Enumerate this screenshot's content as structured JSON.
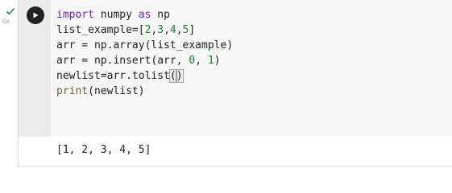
{
  "cell_status": {
    "executed_icon": "check-icon",
    "duration": "0s",
    "success_color": "#1e8e3e"
  },
  "run_button": {
    "icon": "play-icon"
  },
  "code": {
    "lines": [
      [
        {
          "t": "import",
          "c": "kw"
        },
        {
          "t": " numpy "
        },
        {
          "t": "as",
          "c": "kw"
        },
        {
          "t": " np"
        }
      ],
      [
        {
          "t": "list_example=["
        },
        {
          "t": "2",
          "c": "num"
        },
        {
          "t": ","
        },
        {
          "t": "3",
          "c": "num"
        },
        {
          "t": ","
        },
        {
          "t": "4",
          "c": "num"
        },
        {
          "t": ","
        },
        {
          "t": "5",
          "c": "num"
        },
        {
          "t": "]"
        }
      ],
      [
        {
          "t": "arr = np.array(list_example)"
        }
      ],
      [
        {
          "t": "arr = np.insert(arr, "
        },
        {
          "t": "0",
          "c": "num"
        },
        {
          "t": ", "
        },
        {
          "t": "1",
          "c": "num"
        },
        {
          "t": ")"
        }
      ],
      [
        {
          "t": "newlist=arr.tolist"
        },
        {
          "t": "(",
          "c": "paren-hl"
        },
        {
          "t": ")",
          "c": "paren-hl"
        },
        {
          "cursor": true
        }
      ],
      [
        {
          "t": "print",
          "c": "fn"
        },
        {
          "t": "(newlist)"
        }
      ]
    ]
  },
  "output": {
    "text": "[1, 2, 3, 4, 5]"
  }
}
